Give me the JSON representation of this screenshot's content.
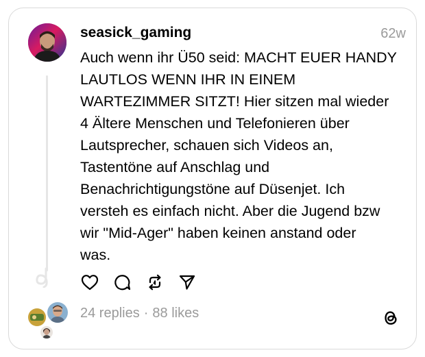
{
  "post": {
    "username": "seasick_gaming",
    "time_ago": "62w",
    "text_lines": [
      "Auch wenn ihr Ü50 seid: MACHT EUER HANDY",
      "LAUTLOS WENN IHR IN EINEM",
      "WARTEZIMMER SITZT! Hier sitzen mal wieder",
      "4 Ältere Menschen und Telefonieren über",
      "Lautsprecher, schauen sich Videos an,",
      "Tastentöne auf Anschlag und",
      "Benachrichtigungstöne auf Düsenjet. Ich",
      "versteh es einfach nicht. Aber die Jugend bzw",
      "wir \"Mid-Ager\" haben keinen anstand oder",
      "was."
    ]
  },
  "stats": {
    "replies": "24 replies",
    "separator": "·",
    "likes": "88 likes"
  },
  "icons": {
    "like": "heart-icon",
    "reply": "comment-icon",
    "repost": "repost-icon",
    "share": "send-icon",
    "brand": "threads-logo-icon"
  },
  "colors": {
    "text": "#000000",
    "muted": "#9a9a9a",
    "border": "#d9d9d9",
    "thread_line": "#e6e6e6"
  }
}
